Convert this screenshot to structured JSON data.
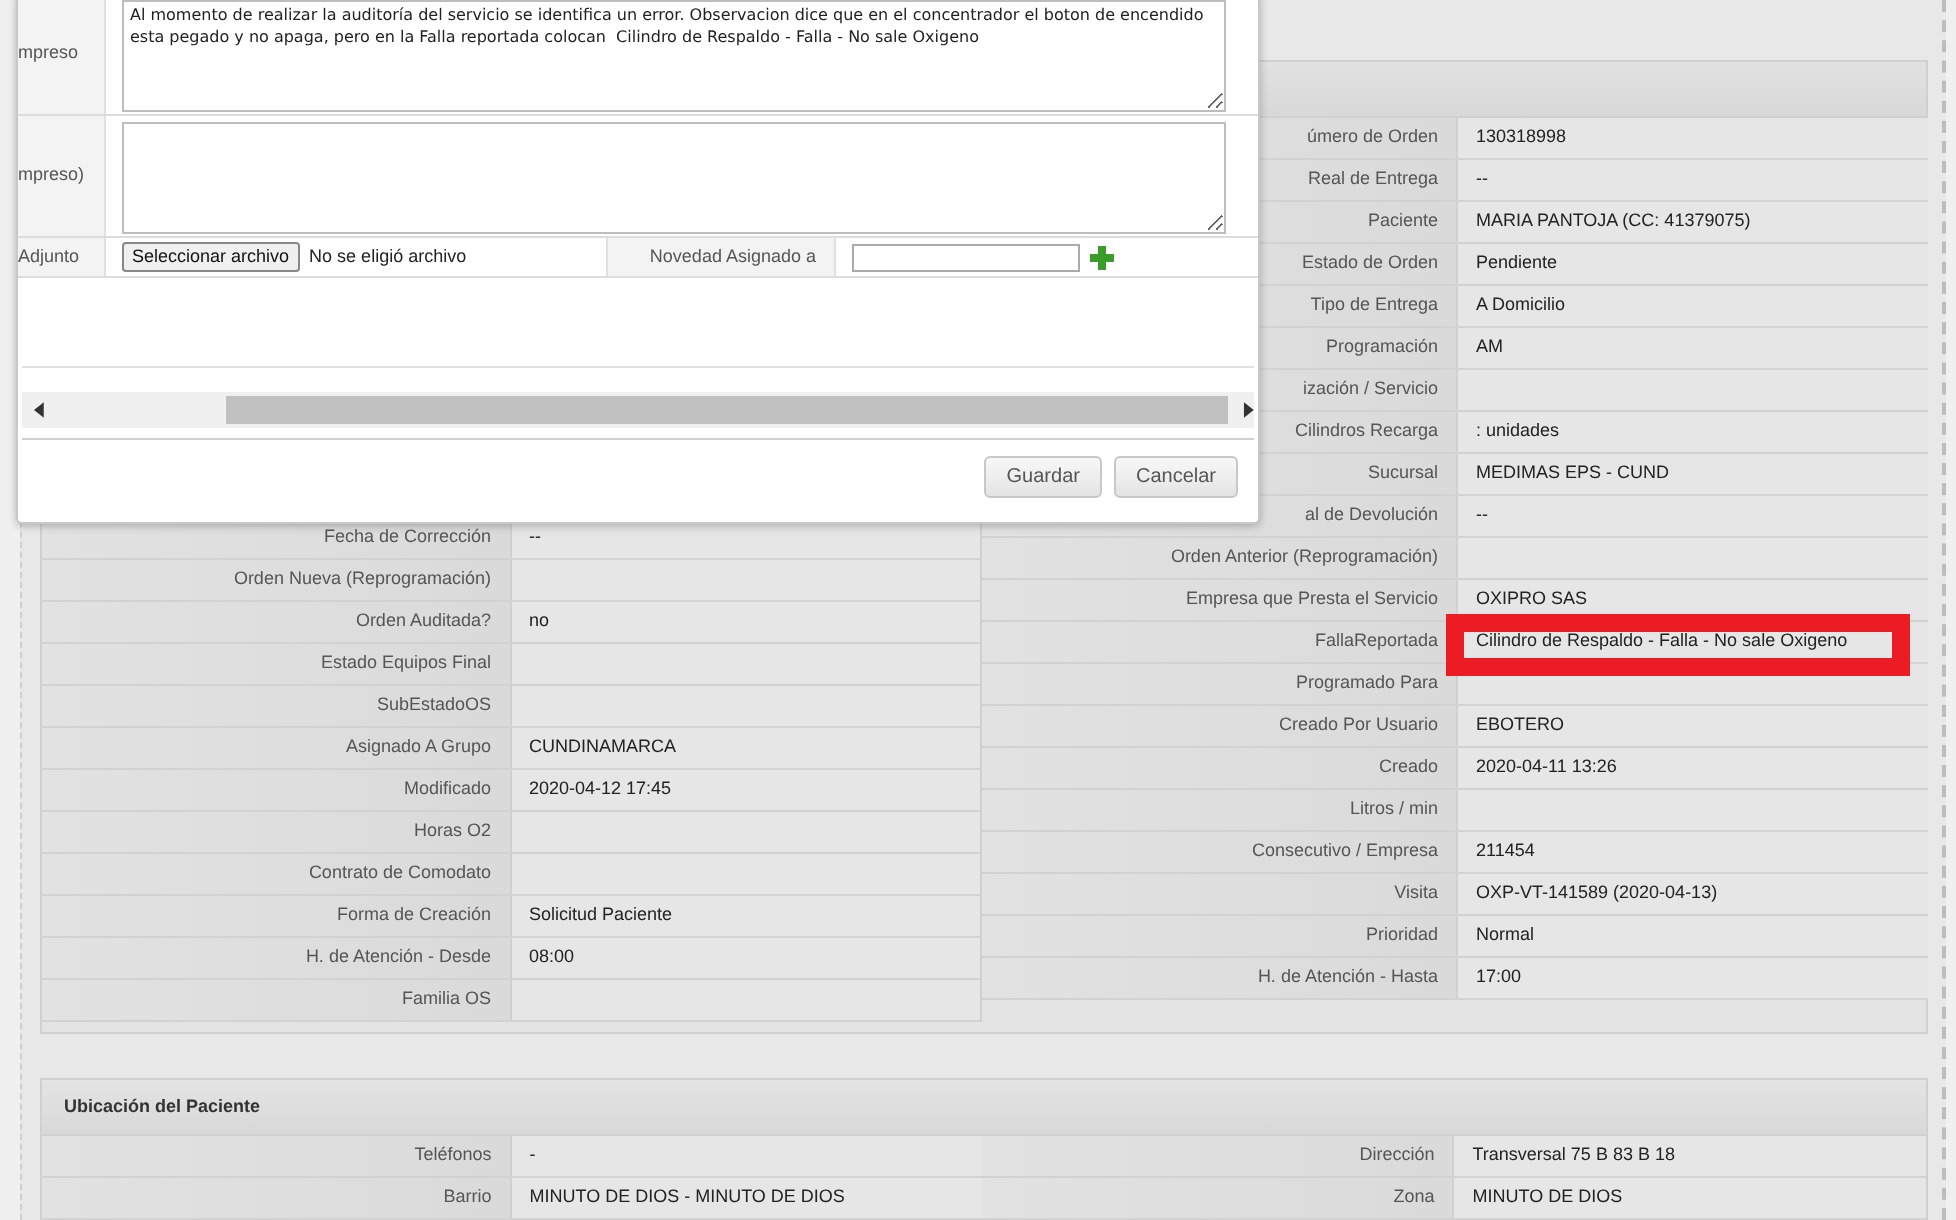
{
  "dialog": {
    "rows": [
      {
        "label": "mpreso",
        "value": "Al momento de realizar la auditoría del servicio se identifica un error. Observacion dice que en el concentrador el boton de encendido esta pegado y no apaga, pero en la Falla reportada colocan  Cilindro de Respaldo - Falla - No sale Oxigeno"
      },
      {
        "label": "mpreso)"
      }
    ],
    "attachment": {
      "label": "Adjunto",
      "button": "Seleccionar archivo",
      "status": "No se eligió archivo",
      "assign_label": "Novedad Asignado a"
    },
    "buttons": [
      "Guardar",
      "Cancelar"
    ]
  },
  "order": {
    "left_rows": [
      {
        "label": "Fecha de Corrección",
        "value": "--"
      },
      {
        "label": "Orden Nueva (Reprogramación)"
      },
      {
        "label": "Orden Auditada?",
        "value": "no"
      },
      {
        "label": "Estado Equipos Final"
      },
      {
        "label": "SubEstadoOS"
      },
      {
        "label": "Asignado A Grupo",
        "value": "CUNDINAMARCA"
      },
      {
        "label": "Modificado",
        "value": "2020-04-12 17:45"
      },
      {
        "label": "Horas O2"
      },
      {
        "label": "Contrato de Comodato"
      },
      {
        "label": "Forma de Creación",
        "value": "Solicitud Paciente"
      },
      {
        "label": "H. de Atención - Desde",
        "value": "08:00"
      },
      {
        "label": "Familia OS"
      }
    ],
    "right_rows": [
      {
        "label": "úmero de Orden",
        "value": "130318998",
        "highlighted": false
      },
      {
        "label": "Real de Entrega",
        "value": "--",
        "highlighted": false
      },
      {
        "label": "Paciente",
        "value": "MARIA PANTOJA (CC: 41379075)",
        "highlighted": false
      },
      {
        "label": "Estado de Orden",
        "value": "Pendiente",
        "highlighted": false
      },
      {
        "label": "Tipo de Entrega",
        "value": "A Domicilio",
        "highlighted": false
      },
      {
        "label": "Programación",
        "value": "AM",
        "highlighted": false
      },
      {
        "label": "ización / Servicio",
        "highlighted": false
      },
      {
        "label": "Cilindros Recarga",
        "value": ": unidades",
        "highlighted": false
      },
      {
        "label": "Sucursal",
        "value": "MEDIMAS EPS - CUND",
        "highlighted": false
      },
      {
        "label": "al de Devolución",
        "value": "--",
        "highlighted": false
      },
      {
        "label": "Orden Anterior (Reprogramación)",
        "highlighted": false
      },
      {
        "label": "Empresa que Presta el Servicio",
        "value": "OXIPRO SAS",
        "highlighted": false
      },
      {
        "label": "FallaReportada",
        "value": "Cilindro de Respaldo - Falla - No sale Oxigeno",
        "highlighted": true
      },
      {
        "label": "Programado Para",
        "highlighted": false
      },
      {
        "label": "Creado Por Usuario",
        "value": "EBOTERO",
        "highlighted": false
      },
      {
        "label": "Creado",
        "value": "2020-04-11 13:26",
        "highlighted": false
      },
      {
        "label": "Litros / min",
        "highlighted": false
      },
      {
        "label": "Consecutivo / Empresa",
        "value": "211454",
        "highlighted": false
      },
      {
        "label": "Visita",
        "value": "OXP-VT-141589 (2020-04-13)",
        "highlighted": false
      },
      {
        "label": "Prioridad",
        "value": "Normal",
        "highlighted": false
      },
      {
        "label": "H. de Atención - Hasta",
        "value": "17:00",
        "highlighted": false
      }
    ]
  },
  "location": {
    "title": "Ubicación del Paciente",
    "rows": [
      {
        "label": "Teléfonos",
        "value": "-",
        "label_2": "Dirección",
        "value_2": "Transversal 75 B 83 B 18"
      },
      {
        "label": "Barrio",
        "value": "MINUTO DE DIOS - MINUTO DE DIOS",
        "label_2": "Zona",
        "value_2": "MINUTO DE DIOS"
      }
    ]
  }
}
